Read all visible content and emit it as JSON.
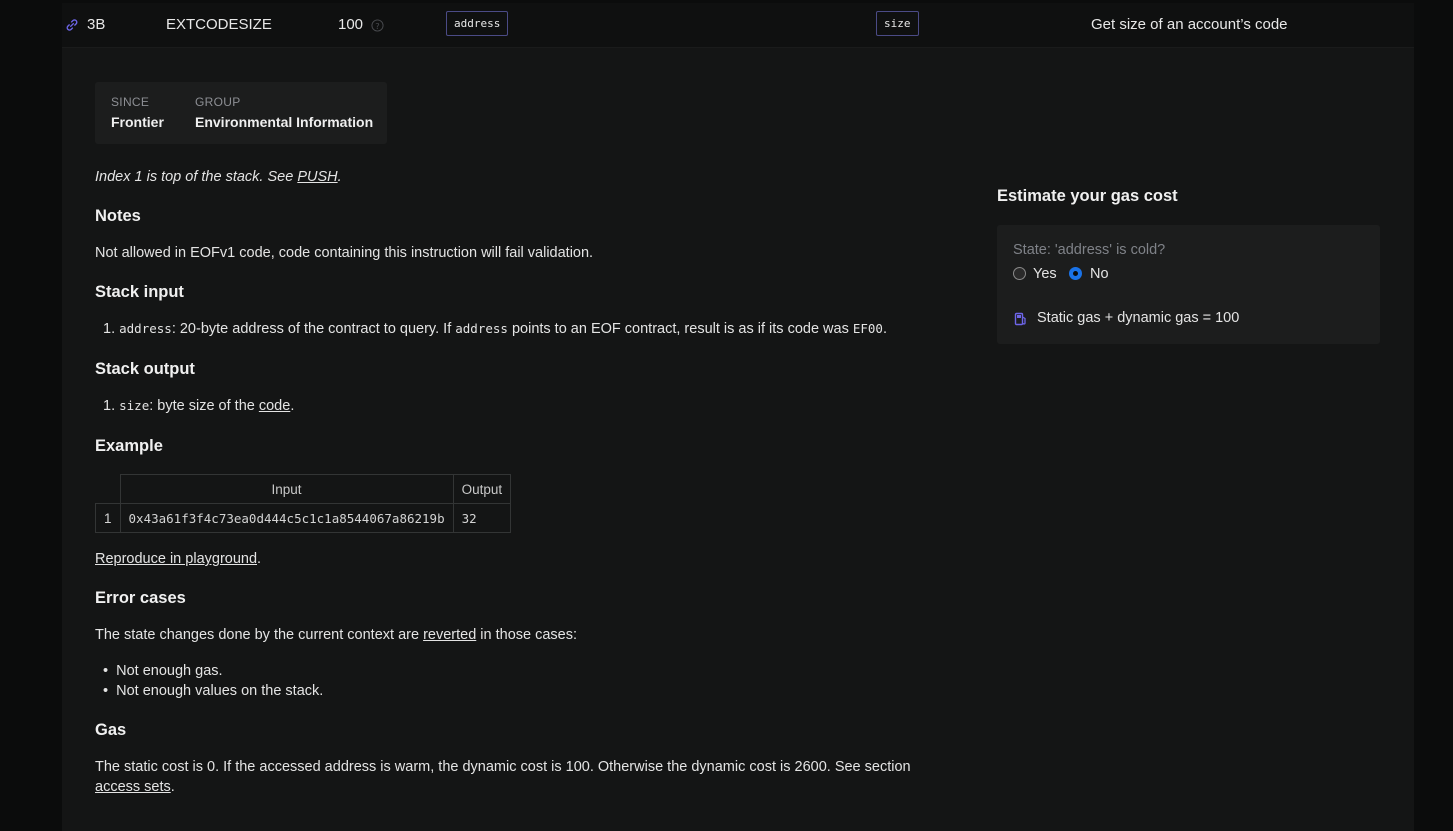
{
  "row": {
    "opcode": "3B",
    "name": "EXTCODESIZE",
    "min_gas": "100",
    "input_tag": "address",
    "output_tag": "size",
    "description": "Get size of an account’s code"
  },
  "meta": {
    "since_label": "SINCE",
    "since_value": "Frontier",
    "group_label": "GROUP",
    "group_value": "Environmental Information"
  },
  "stack_note": {
    "text": "Index 1 is top of the stack. See ",
    "link": "PUSH",
    "end": "."
  },
  "notes": {
    "heading": "Notes",
    "text": "Not allowed in EOFv1 code, code containing this instruction will fail validation."
  },
  "stack_input": {
    "heading": "Stack input",
    "num": "1.",
    "code1": "address",
    "text1": ": 20-byte address of the contract to query. If ",
    "code2": "address",
    "text2": " points to an EOF contract, result is as if its code was ",
    "code3": "EF00",
    "text3": "."
  },
  "stack_output": {
    "heading": "Stack output",
    "num": "1.",
    "code": "size",
    "text": ": byte size of the ",
    "link": "code",
    "end": "."
  },
  "example": {
    "heading": "Example",
    "col_input": "Input",
    "col_output": "Output",
    "row_index": "1",
    "input": "0x43a61f3f4c73ea0d444c5c1c1a8544067a86219b",
    "output": "32",
    "playground_link": "Reproduce in playground",
    "playground_end": "."
  },
  "errors": {
    "heading": "Error cases",
    "text": "The state changes done by the current context are ",
    "link": "reverted",
    "text_end": " in those cases:",
    "items": [
      "Not enough gas.",
      "Not enough values on the stack."
    ]
  },
  "gas": {
    "heading": "Gas",
    "line1": "The static cost is 0. If the accessed address is warm, the dynamic cost is 100. Otherwise the dynamic cost is 2600. See section",
    "link": "access sets",
    "end": "."
  },
  "estimator": {
    "heading": "Estimate your gas cost",
    "question": "State: 'address' is cold?",
    "yes_label": "Yes",
    "no_label": "No",
    "selected": "No",
    "result": "Static gas + dynamic gas = 100"
  },
  "colors": {
    "accent": "#6a5acd",
    "link_icon": "#6d65e8",
    "radio_selected": "#1a73e8"
  },
  "icons": [
    "link-icon",
    "help-icon",
    "fuel-pump-icon"
  ]
}
